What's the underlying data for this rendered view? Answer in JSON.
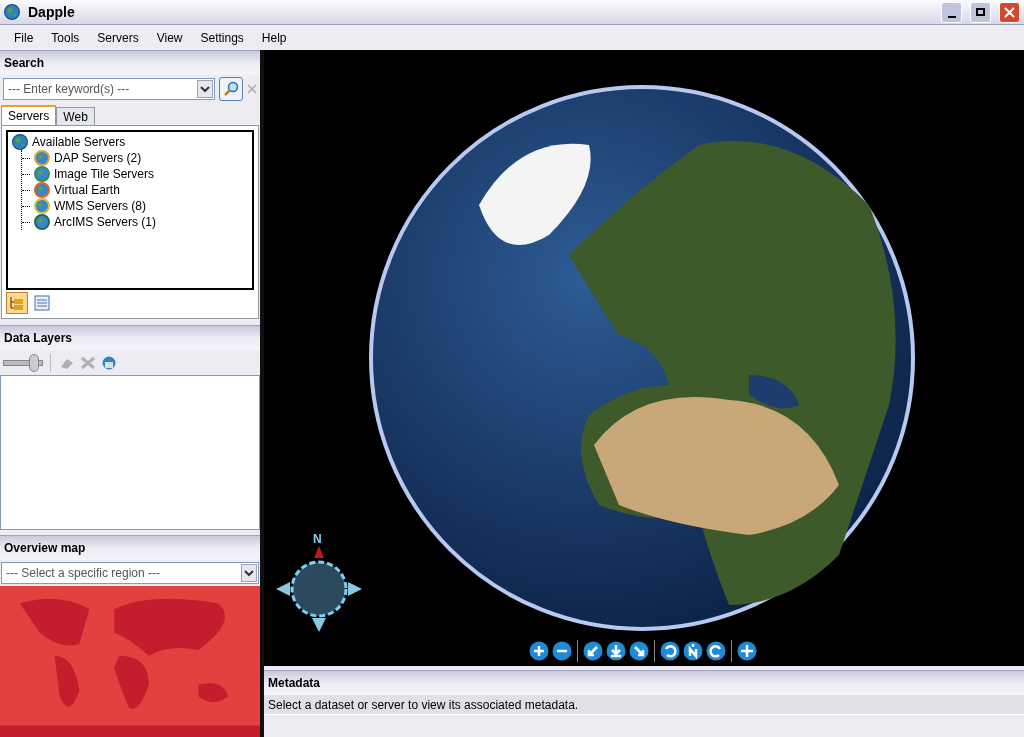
{
  "window": {
    "title": "Dapple"
  },
  "menu": [
    "File",
    "Tools",
    "Servers",
    "View",
    "Settings",
    "Help"
  ],
  "search": {
    "title": "Search",
    "placeholder": "--- Enter keyword(s) ---"
  },
  "tabs": [
    {
      "label": "Servers",
      "selected": true
    },
    {
      "label": "Web",
      "selected": false
    }
  ],
  "server_tree": {
    "label": "Available Servers",
    "children": [
      {
        "label": "DAP Servers (2)",
        "kind": "dap"
      },
      {
        "label": "Image Tile Servers",
        "kind": "tile"
      },
      {
        "label": "Virtual Earth",
        "kind": "ve"
      },
      {
        "label": "WMS Servers (8)",
        "kind": "wms"
      },
      {
        "label": "ArcIMS Servers (1)",
        "kind": "arcims"
      }
    ]
  },
  "view_modes": [
    {
      "kind": "tree",
      "selected": true
    },
    {
      "kind": "list",
      "selected": false
    }
  ],
  "data_layers": {
    "title": "Data Layers",
    "opacity": {
      "level": 0.85
    },
    "tools": [
      {
        "kind": "add",
        "disabled": true
      },
      {
        "kind": "remove",
        "disabled": true
      },
      {
        "kind": "refresh",
        "disabled": false
      }
    ]
  },
  "overview": {
    "title": "Overview map",
    "placeholder": "--- Select a specific region ---"
  },
  "compass": {
    "north": "N"
  },
  "metadata": {
    "title": "Metadata",
    "text": "Select a dataset or server to view its associated metadata."
  }
}
